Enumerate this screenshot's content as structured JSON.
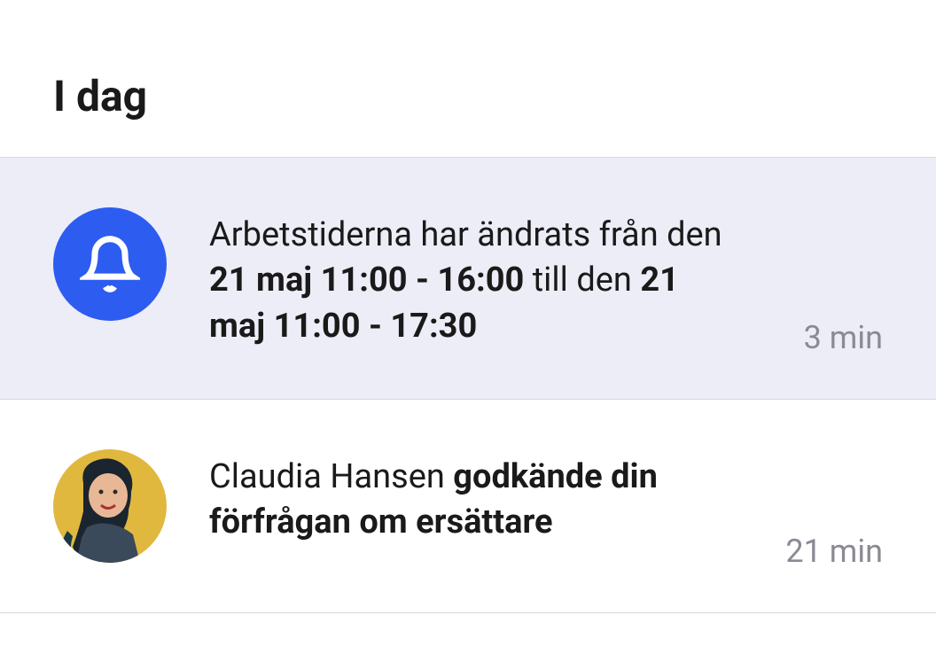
{
  "header": {
    "title": "I dag"
  },
  "notifications": [
    {
      "icon": "bell",
      "unread": true,
      "text_parts": [
        {
          "text": "Arbetstiderna har ändrats från den ",
          "bold": false
        },
        {
          "text": "21 maj 11:00 - 16:00",
          "bold": true
        },
        {
          "text": " till den ",
          "bold": false
        },
        {
          "text": "21 maj 11:00 - 17:30",
          "bold": true
        }
      ],
      "time": "3 min"
    },
    {
      "icon": "avatar",
      "unread": false,
      "avatar_name": "Claudia Hansen",
      "text_parts": [
        {
          "text": "Claudia Hansen ",
          "bold": false
        },
        {
          "text": "godkände din förfrågan om ersättare",
          "bold": true
        }
      ],
      "time": "21 min"
    }
  ],
  "colors": {
    "accent": "#2d5cf0",
    "unread_bg": "#ededf7",
    "text_muted": "#8a8a94"
  }
}
